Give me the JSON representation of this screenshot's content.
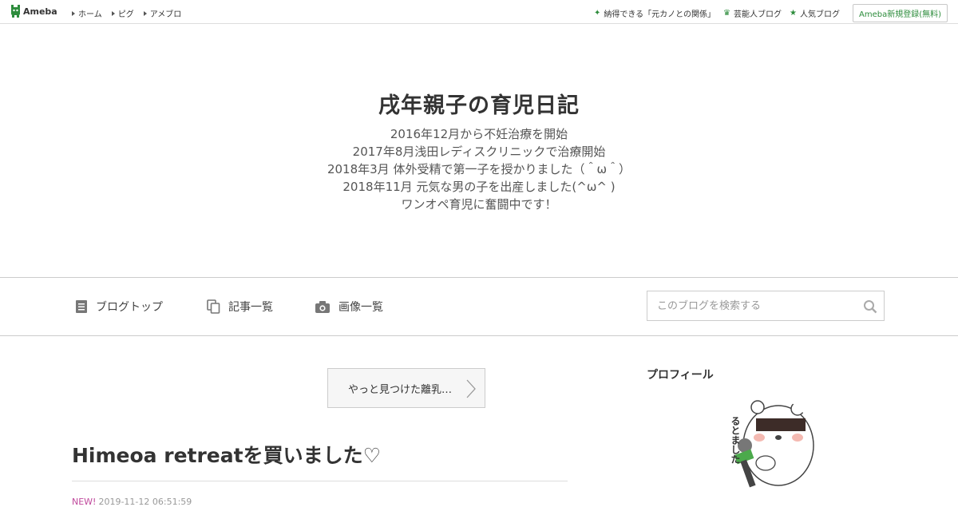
{
  "topbar": {
    "logo_text": "Ameba",
    "nav": [
      "ホーム",
      "ピグ",
      "アメブロ"
    ],
    "links": [
      {
        "icon": "sparkle-icon",
        "label": "納得できる「元カノとの関係」"
      },
      {
        "icon": "crown-icon",
        "label": "芸能人ブログ"
      },
      {
        "icon": "star-icon",
        "label": "人気ブログ"
      }
    ],
    "signup_label": "Ameba新規登録(無料)"
  },
  "header": {
    "title": "戌年親子の育児日記",
    "description": [
      "2016年12月から不妊治療を開始",
      "2017年8月浅田レディスクリニックで治療開始",
      "2018年3月 体外受精で第一子を授かりました（＾ω＾）",
      "2018年11月 元気な男の子を出産しました(^ω^ )",
      "ワンオペ育児に奮闘中です！"
    ]
  },
  "nav": {
    "items": [
      {
        "icon": "document-icon",
        "label": "ブログトップ"
      },
      {
        "icon": "copy-icon",
        "label": "記事一覧"
      },
      {
        "icon": "camera-icon",
        "label": "画像一覧"
      }
    ],
    "search_placeholder": "このブログを検索する"
  },
  "main": {
    "prev_entry_label": "やっと見つけた離乳…",
    "entry_title": "Himeoa retreatを買いました♡",
    "new_badge": "NEW!",
    "date": "2019-11-12 06:51:59"
  },
  "sidebar": {
    "profile_heading": "プロフィール",
    "avatar_text": "るとました"
  },
  "colors": {
    "accent_green": "#2d8c3c",
    "new_badge": "#c0489c"
  }
}
